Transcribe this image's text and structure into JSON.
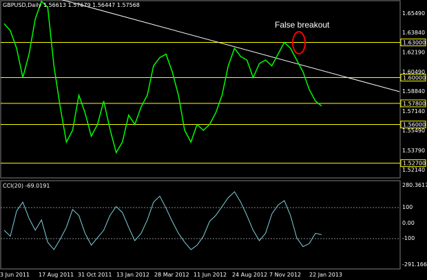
{
  "header": {
    "title_text": "GBPUSD,Daily  1.56613 1.57679 1.56447 1.57568"
  },
  "indicator": {
    "label": "CCI(20) -69.0191",
    "levels": [
      "280.3617",
      "100",
      "0.00",
      "-100",
      "-291.1664"
    ]
  },
  "annotation": {
    "text": "False breakout"
  },
  "price_axis": {
    "labels": [
      "1.65490",
      "1.63840",
      "1.62190",
      "1.60490",
      "1.58840",
      "1.57140",
      "1.55490",
      "1.53790",
      "1.52140"
    ],
    "highlighted": [
      "1.63000",
      "1.60000",
      "1.57800",
      "1.56000",
      "1.52700"
    ]
  },
  "time_axis": {
    "labels": [
      "3 Jun 2011",
      "17 Aug 2011",
      "31 Oct 2011",
      "13 Jan 2012",
      "28 Mar 2012",
      "11 Jun 2012",
      "24 Aug 2012",
      "7 Nov 2012",
      "22 Jan 2013"
    ]
  },
  "colors": {
    "background": "#000000",
    "candles": "#00ff00",
    "levels": "#ffff00",
    "trendline": "#ffffff",
    "cci": "#7fd3e0",
    "breakout_circle": "#ff0000"
  },
  "chart_data": {
    "type": "line",
    "x_labels": [
      "3 Jun 2011",
      "17 Aug 2011",
      "31 Oct 2011",
      "13 Jan 2012",
      "28 Mar 2012",
      "11 Jun 2012",
      "24 Aug 2012",
      "7 Nov 2012",
      "22 Jan 2013"
    ],
    "price_series": [
      1.646,
      1.64,
      1.625,
      1.6,
      1.62,
      1.65,
      1.665,
      1.66,
      1.61,
      1.575,
      1.545,
      1.555,
      1.585,
      1.57,
      1.55,
      1.56,
      1.58,
      1.556,
      1.536,
      1.545,
      1.568,
      1.56,
      1.575,
      1.585,
      1.61,
      1.617,
      1.62,
      1.605,
      1.585,
      1.555,
      1.545,
      1.56,
      1.555,
      1.56,
      1.57,
      1.585,
      1.61,
      1.625,
      1.618,
      1.615,
      1.6,
      1.612,
      1.615,
      1.61,
      1.62,
      1.63,
      1.625,
      1.615,
      1.605,
      1.59,
      1.58,
      1.5757
    ],
    "horizontal_levels": [
      1.63,
      1.6,
      1.578,
      1.56,
      1.527
    ],
    "trendline": {
      "from": 1.672,
      "to": 1.588
    },
    "cci_series": [
      -40,
      -80,
      90,
      150,
      40,
      -40,
      30,
      -120,
      -170,
      -100,
      -20,
      100,
      60,
      -60,
      -140,
      -90,
      -40,
      60,
      120,
      80,
      -20,
      -110,
      -60,
      30,
      150,
      190,
      110,
      20,
      -60,
      -120,
      -170,
      -140,
      -80,
      20,
      60,
      120,
      180,
      220,
      150,
      60,
      -40,
      -110,
      -60,
      70,
      130,
      160,
      60,
      -90,
      -150,
      -130,
      -60,
      -69
    ],
    "cci_range": [
      -291.1664,
      280.3617
    ],
    "y_range": [
      1.515,
      1.665
    ]
  }
}
